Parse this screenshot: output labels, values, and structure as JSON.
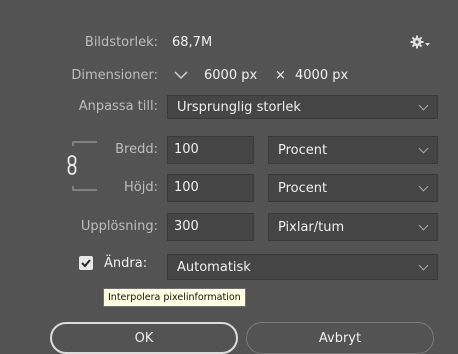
{
  "image_size": {
    "label": "Bildstorlek:",
    "value": "68,7M"
  },
  "dimensions": {
    "label": "Dimensioner:",
    "width_value": "6000 px",
    "separator": "×",
    "height_value": "4000 px"
  },
  "fit_to": {
    "label": "Anpassa till:",
    "selected": "Ursprunglig storlek"
  },
  "width": {
    "label": "Bredd:",
    "value": "100",
    "unit": "Procent"
  },
  "height": {
    "label": "Höjd:",
    "value": "100",
    "unit": "Procent"
  },
  "resolution": {
    "label": "Upplösning:",
    "value": "300",
    "unit": "Pixlar/tum"
  },
  "resample": {
    "label": "Ändra:",
    "checked": true,
    "selected": "Automatisk"
  },
  "tooltip": {
    "text": "Interpolera pixelinformation"
  },
  "buttons": {
    "ok": "OK",
    "cancel": "Avbryt"
  },
  "icons": {
    "settings": "gear-icon",
    "link": "chain-link-icon",
    "dimension_toggle": "chevron-down-icon",
    "checkbox": "checkmark-icon"
  },
  "colors": {
    "background": "#535353",
    "field": "#454545",
    "tooltip_bg": "#ffffe1"
  }
}
